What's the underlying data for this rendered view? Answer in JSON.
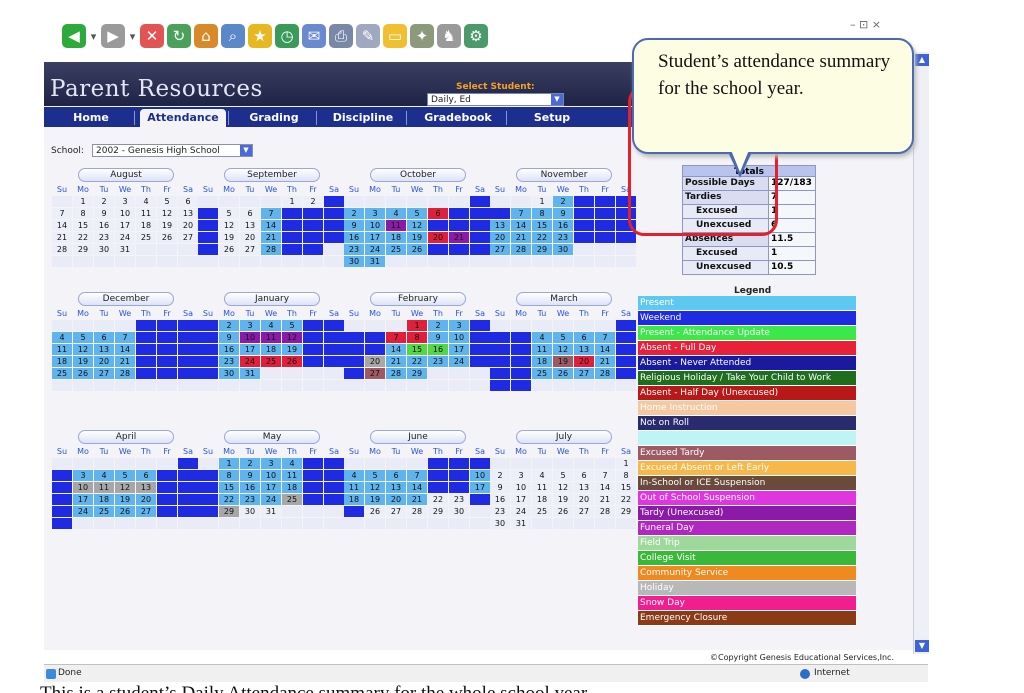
{
  "browser": {
    "status": "Done",
    "zone": "Internet",
    "window_controls": "– ⊡ ×"
  },
  "app": {
    "title": "Parent Resources",
    "select_student": {
      "label": "Select Student:",
      "value": "Daily, Ed"
    },
    "tabs": [
      "Home",
      "Attendance",
      "Grading",
      "Discipline",
      "Gradebook",
      "Setup"
    ],
    "active_tab": "Attendance",
    "school": {
      "label": "School:",
      "value": "2002 - Genesis High School"
    },
    "day_headers": [
      "Su",
      "Mo",
      "Tu",
      "We",
      "Th",
      "Fr",
      "Sa"
    ],
    "copyright": "©Copyright Genesis Educational Services,Inc."
  },
  "calendar": [
    {
      "name": "August",
      "start": 1,
      "days": 31,
      "codes": {}
    },
    {
      "name": "September",
      "start": 4,
      "days": 30,
      "codes": {
        "8": "w",
        "9": "w",
        "10": "w",
        "15": "w",
        "16": "w",
        "17": "w",
        "22": "w",
        "23": "w",
        "24": "w",
        "29": "w",
        "30": "w",
        "7": "p",
        "14": "p",
        "21": "p",
        "28": "p"
      }
    },
    {
      "name": "October",
      "start": 6,
      "days": 31,
      "codes": {
        "1": "w",
        "6": "a",
        "7": "w",
        "8": "w",
        "13": "w",
        "14": "w",
        "15": "w",
        "20": "a",
        "21": "t",
        "22": "w",
        "27": "w",
        "28": "w",
        "29": "w",
        "2": "p",
        "3": "p",
        "4": "p",
        "5": "p",
        "9": "p",
        "10": "p",
        "12": "p",
        "16": "p",
        "17": "p",
        "18": "p",
        "19": "p",
        "23": "p",
        "24": "p",
        "25": "p",
        "26": "p",
        "30": "p",
        "31": "p",
        "11": "t",
        "11x": "a"
      }
    },
    {
      "name": "November",
      "start": 2,
      "days": 30,
      "codes": {
        "3": "w",
        "4": "w",
        "5": "w",
        "10": "w",
        "11": "w",
        "12": "w",
        "17": "w",
        "18": "w",
        "19": "w",
        "24": "w",
        "25": "w",
        "26": "w",
        "2": "p",
        "7": "p",
        "8": "p",
        "9": "p",
        "13": "p",
        "14": "p",
        "15": "p",
        "16": "p",
        "20": "p",
        "21": "p",
        "22": "p",
        "23": "p",
        "27": "p",
        "28": "p",
        "29": "p",
        "30": "p",
        "10x": "x",
        "11x": "x",
        "24x": "x",
        "25x": "x"
      }
    },
    {
      "name": "December",
      "start": 4,
      "days": 31,
      "codes": {
        "1": "w",
        "2": "w",
        "3": "w",
        "8": "w",
        "9": "w",
        "10": "w",
        "15": "w",
        "16": "w",
        "17": "w",
        "22": "w",
        "23": "w",
        "24": "w",
        "29": "w",
        "30": "w",
        "31": "w",
        "4": "p",
        "5": "p",
        "6": "p",
        "7": "p",
        "11": "p",
        "12": "p",
        "13": "p",
        "14": "p",
        "18": "p",
        "19": "p",
        "20": "p",
        "21": "p",
        "25": "p",
        "26": "p",
        "27": "p",
        "28": "p"
      }
    },
    {
      "name": "January",
      "start": 0,
      "days": 31,
      "codes": {
        "6": "w",
        "7": "w",
        "13": "w",
        "14": "w",
        "20": "w",
        "21": "w",
        "27": "w",
        "28": "w",
        "1": "w",
        "8": "w",
        "15": "w",
        "22": "w",
        "29": "w",
        "2": "p",
        "3": "p",
        "4": "p",
        "5": "p",
        "9": "p",
        "10": "t",
        "11": "t",
        "12": "t",
        "16": "p",
        "17": "p",
        "18": "p",
        "19": "p",
        "23": "p",
        "24": "a",
        "25": "a",
        "26": "a",
        "30": "p",
        "31": "p"
      }
    },
    {
      "name": "February",
      "start": 3,
      "days": 29,
      "codes": {
        "4": "w",
        "5": "w",
        "6": "w",
        "11": "w",
        "12": "w",
        "13": "w",
        "18": "w",
        "19": "w",
        "20": "x",
        "25": "w",
        "26": "w",
        "27": "ex",
        "1": "a",
        "2": "p",
        "3": "p",
        "7": "a",
        "8": "a",
        "9": "p",
        "10": "p",
        "14": "p",
        "15": "g",
        "16": "g",
        "17": "p",
        "21": "p",
        "22": "p",
        "23": "p",
        "24": "p",
        "28": "p",
        "29": "p"
      }
    },
    {
      "name": "March",
      "start": 6,
      "days": 31,
      "codes": {
        "1": "w",
        "2": "w",
        "3": "w",
        "8": "w",
        "9": "w",
        "10": "w",
        "15": "w",
        "16": "w",
        "17": "w",
        "22": "w",
        "23": "w",
        "24": "w",
        "29": "w",
        "30": "w",
        "31": "w",
        "4": "p",
        "5": "p",
        "6": "p",
        "7": "p",
        "11": "p",
        "12": "p",
        "13": "p",
        "14": "p",
        "18": "p",
        "19": "ex",
        "20": "a",
        "21": "p",
        "25": "p",
        "26": "p",
        "27": "p",
        "28": "p"
      }
    },
    {
      "name": "April",
      "start": 6,
      "days": 30,
      "codes": {
        "1": "w",
        "2": "w",
        "8": "w",
        "9": "w",
        "15": "w",
        "16": "w",
        "22": "w",
        "23": "w",
        "29": "w",
        "30": "w",
        "7": "w",
        "14": "w",
        "21": "w",
        "28": "w",
        "3": "p",
        "4": "p",
        "5": "p",
        "6": "p",
        "10": "x",
        "11": "x",
        "12": "x",
        "13": "x",
        "17": "p",
        "18": "p",
        "19": "p",
        "20": "p",
        "24": "p",
        "25": "p",
        "26": "p",
        "27": "p"
      }
    },
    {
      "name": "May",
      "start": 1,
      "days": 31,
      "codes": {
        "5": "w",
        "6": "w",
        "12": "w",
        "13": "w",
        "19": "w",
        "20": "w",
        "26": "w",
        "27": "w",
        "7": "w",
        "14": "w",
        "21": "w",
        "28": "w",
        "1": "p",
        "2": "p",
        "3": "p",
        "4": "p",
        "8": "p",
        "9": "p",
        "10": "p",
        "11": "p",
        "15": "p",
        "16": "p",
        "17": "p",
        "18": "p",
        "22": "p",
        "23": "p",
        "24": "p",
        "25": "x",
        "26x": "x",
        "29": "x"
      }
    },
    {
      "name": "June",
      "start": 4,
      "days": 30,
      "codes": {
        "1": "w",
        "2": "w",
        "8": "w",
        "9": "w",
        "15": "w",
        "16": "w",
        "3": "w",
        "4": "p",
        "5": "p",
        "6": "p",
        "7": "p",
        "10": "p",
        "11": "p",
        "12": "p",
        "13": "p",
        "14": "p",
        "17": "p",
        "18": "p",
        "19": "p",
        "20": "p",
        "21": "p"
      }
    },
    {
      "name": "July",
      "start": 6,
      "days": 31,
      "codes": {}
    }
  ],
  "totals": {
    "title": "Totals",
    "rows": [
      {
        "label": "Possible Days",
        "value": "127/183",
        "indent": false
      },
      {
        "label": "Tardies",
        "value": "7",
        "indent": false
      },
      {
        "label": "Excused",
        "value": "1",
        "indent": true
      },
      {
        "label": "Unexcused",
        "value": "6",
        "indent": true
      },
      {
        "label": "Absences",
        "value": "11.5",
        "indent": false
      },
      {
        "label": "Excused",
        "value": "1",
        "indent": true
      },
      {
        "label": "Unexcused",
        "value": "10.5",
        "indent": true
      }
    ]
  },
  "legend": {
    "title": "Legend",
    "items": [
      {
        "label": "Present",
        "bg": "#5fc8f0",
        "fg": "#ffffff"
      },
      {
        "label": "Weekend",
        "bg": "#1e2be2",
        "fg": "#ffffff"
      },
      {
        "label": "Present - Attendance Update",
        "bg": "#3be84a",
        "fg": "#ffffff"
      },
      {
        "label": "Absent - Full Day",
        "bg": "#e8203a",
        "fg": "#ffffff"
      },
      {
        "label": "Absent - Never Attended",
        "bg": "#1a1a9e",
        "fg": "#ffffff"
      },
      {
        "label": "Religious Holiday / Take Your Child to Work",
        "bg": "#1e6e1e",
        "fg": "#ffffff"
      },
      {
        "label": "Absent - Half Day (Unexcused)",
        "bg": "#b81818",
        "fg": "#ffffff"
      },
      {
        "label": "Home Instruction",
        "bg": "#f6c8a0",
        "fg": "#ffffff"
      },
      {
        "label": "Not on Roll",
        "bg": "#2a2a6e",
        "fg": "#ffffff"
      },
      {
        "label": "",
        "bg": "#bff4f6",
        "fg": "#ffffff"
      },
      {
        "label": "Excused Tardy",
        "bg": "#9e5a64",
        "fg": "#ffffff"
      },
      {
        "label": "Excused Absent or Left Early",
        "bg": "#f6b84a",
        "fg": "#ffffff"
      },
      {
        "label": "In-School or ICE Suspension",
        "bg": "#6a4a3a",
        "fg": "#ffffff"
      },
      {
        "label": "Out of School Suspension",
        "bg": "#e036e0",
        "fg": "#ffffff"
      },
      {
        "label": "Tardy (Unexcused)",
        "bg": "#8c1aa8",
        "fg": "#ffffff"
      },
      {
        "label": "Funeral Day",
        "bg": "#b028c0",
        "fg": "#ffffff"
      },
      {
        "label": "Field Trip",
        "bg": "#9ed89a",
        "fg": "#ffffff"
      },
      {
        "label": "College Visit",
        "bg": "#3ab83a",
        "fg": "#ffffff"
      },
      {
        "label": "Community Service",
        "bg": "#f08a20",
        "fg": "#ffffff"
      },
      {
        "label": "Holiday",
        "bg": "#b8b8b8",
        "fg": "#ffffff"
      },
      {
        "label": "Snow Day",
        "bg": "#f01e8e",
        "fg": "#ffffff"
      },
      {
        "label": "Emergency Closure",
        "bg": "#8a3a14",
        "fg": "#ffffff"
      }
    ]
  },
  "callout": {
    "text": "Student’s attendance summary for the school year."
  },
  "caption": "This is a student’s Daily Attendance summary for the whole school year."
}
